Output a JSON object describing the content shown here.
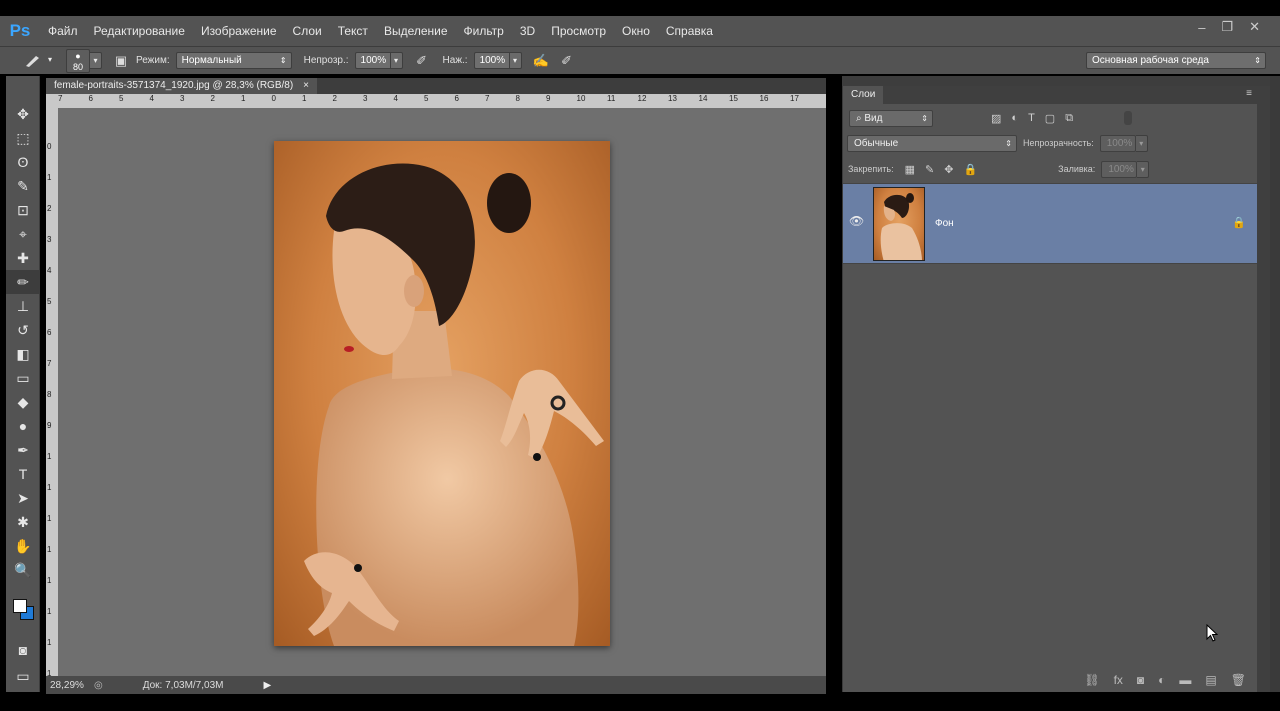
{
  "app": {
    "logo": "Ps",
    "menu": [
      "Файл",
      "Редактирование",
      "Изображение",
      "Слои",
      "Текст",
      "Выделение",
      "Фильтр",
      "3D",
      "Просмотр",
      "Окно",
      "Справка"
    ],
    "window_controls": [
      "–",
      "❐",
      "✕"
    ]
  },
  "options_bar": {
    "brush_size": "80",
    "mode_label": "Режим:",
    "mode_value": "Нормальный",
    "opacity_label": "Непрозр.:",
    "opacity_value": "100%",
    "flow_label": "Наж.:",
    "flow_value": "100%",
    "workspace": "Основная рабочая среда"
  },
  "document": {
    "tab_title": "female-portraits-3571374_1920.jpg @ 28,3% (RGB/8)",
    "tab_close": "×",
    "ruler_top": [
      "7",
      "6",
      "5",
      "4",
      "3",
      "2",
      "1",
      "0",
      "1",
      "2",
      "3",
      "4",
      "5",
      "6",
      "7",
      "8",
      "9",
      "10",
      "11",
      "12",
      "13",
      "14",
      "15",
      "16",
      "17"
    ],
    "ruler_left": [
      "0",
      "1",
      "2",
      "3",
      "4",
      "5",
      "6",
      "7",
      "8",
      "9",
      "1",
      "1",
      "1",
      "1",
      "1",
      "1",
      "1",
      "1",
      "1"
    ],
    "zoom": "28,29%",
    "doc_info": "Док: 7,03M/7,03M"
  },
  "tools": [
    "move-icon",
    "marquee-icon",
    "lasso-icon",
    "quick-select-icon",
    "crop-icon",
    "eyedropper-icon",
    "healing-brush-icon",
    "brush-icon",
    "stamp-icon",
    "history-brush-icon",
    "eraser-icon",
    "gradient-icon",
    "blur-icon",
    "dodge-icon",
    "pen-icon",
    "type-icon",
    "path-select-icon",
    "shape-icon",
    "hand-icon",
    "zoom-icon"
  ],
  "tool_glyphs": [
    "✥",
    "⬚",
    "ʘ",
    "✎",
    "⊡",
    "⌖",
    "✚",
    "✏",
    "⊥",
    "↺",
    "◧",
    "▭",
    "◆",
    "●",
    "✒",
    "T",
    "➤",
    "✱",
    "✋",
    "🔍"
  ],
  "layers_panel": {
    "tab": "Слои",
    "filter": "Вид",
    "blend_mode": "Обычные",
    "opacity_label": "Непрозрачность:",
    "opacity_value": "100%",
    "lock_label": "Закрепить:",
    "fill_label": "Заливка:",
    "fill_value": "100%",
    "layer_name": "Фон"
  },
  "colors": {
    "panel_bg": "#535353",
    "canvas_bg": "#6f6f6f",
    "layer_selected": "#6a7fa5",
    "ps_blue": "#3ba6ff",
    "foreground": "#ffffff",
    "background": "#1f7ad6"
  }
}
